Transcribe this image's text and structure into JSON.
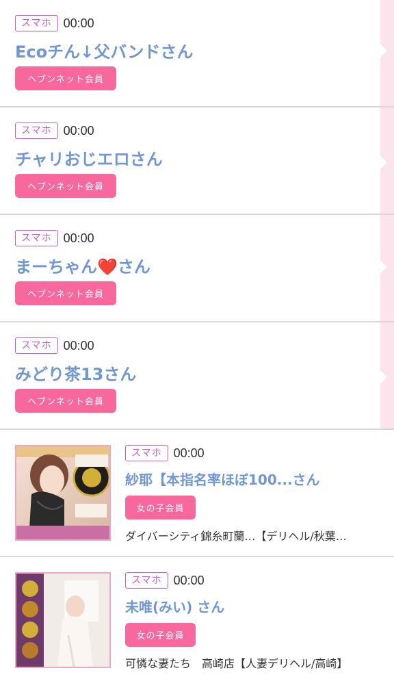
{
  "entries": [
    {
      "device": "スマホ",
      "time": "00:00",
      "name": "Ecoチん↓父バンドさん",
      "member": "ヘブンネット会員"
    },
    {
      "device": "スマホ",
      "time": "00:00",
      "name": "チャリおじエロさん",
      "member": "ヘブンネット会員"
    },
    {
      "device": "スマホ",
      "time": "00:00",
      "name": "まーちゃん❤️さん",
      "member": "ヘブンネット会員"
    },
    {
      "device": "スマホ",
      "time": "00:00",
      "name": "みどり茶13さん",
      "member": "ヘブンネット会員"
    }
  ],
  "image_entries": [
    {
      "device": "スマホ",
      "time": "00:00",
      "name": "紗耶【本指名率ほぼ100...さん",
      "member": "女の子会員",
      "shop": "ダイバーシティ錦糸町蘭…【デリヘル/秋葉…"
    },
    {
      "device": "スマホ",
      "time": "00:00",
      "name": "未唯(みい) さん",
      "member": "女の子会員",
      "shop": "可憐な妻たち　高崎店【人妻デリヘル/高崎】"
    }
  ],
  "colors": {
    "name": "#6f97d6",
    "member_btn": "#f8689d",
    "badge": "#c65ad0",
    "strip": "#fde3ec"
  }
}
